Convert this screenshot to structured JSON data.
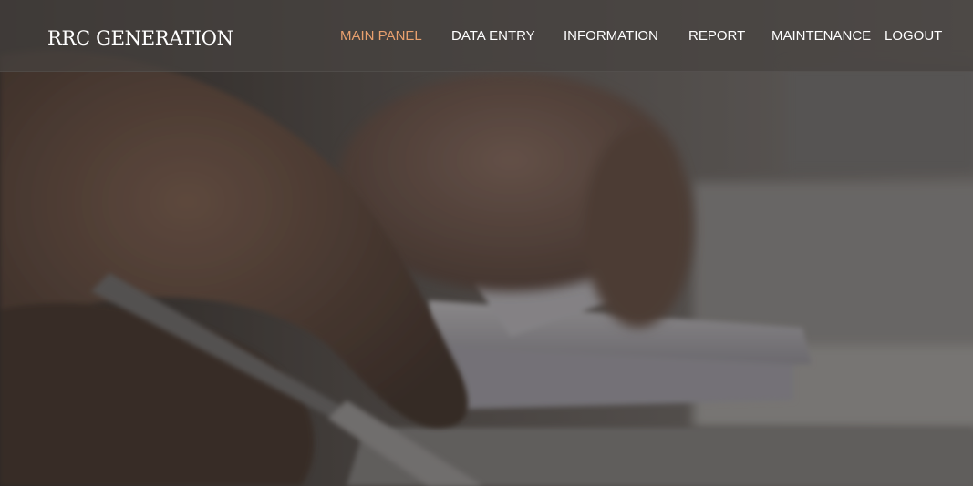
{
  "brand": {
    "title": "RRC GENERATION"
  },
  "nav": {
    "items": [
      {
        "label": "MAIN PANEL",
        "active": true
      },
      {
        "label": "DATA ENTRY",
        "active": false
      },
      {
        "label": "INFORMATION",
        "active": false
      },
      {
        "label": "REPORT",
        "active": false
      },
      {
        "label": "MAINTENANCE",
        "active": false
      },
      {
        "label": "LOGOUT",
        "active": false
      }
    ]
  },
  "colors": {
    "active_nav": "#e8a06e",
    "nav_text": "#ffffff",
    "navbar_bg": "rgba(70,66,64,0.72)"
  },
  "hero": {
    "image": "hands-writing-with-pen-and-papers-background"
  }
}
